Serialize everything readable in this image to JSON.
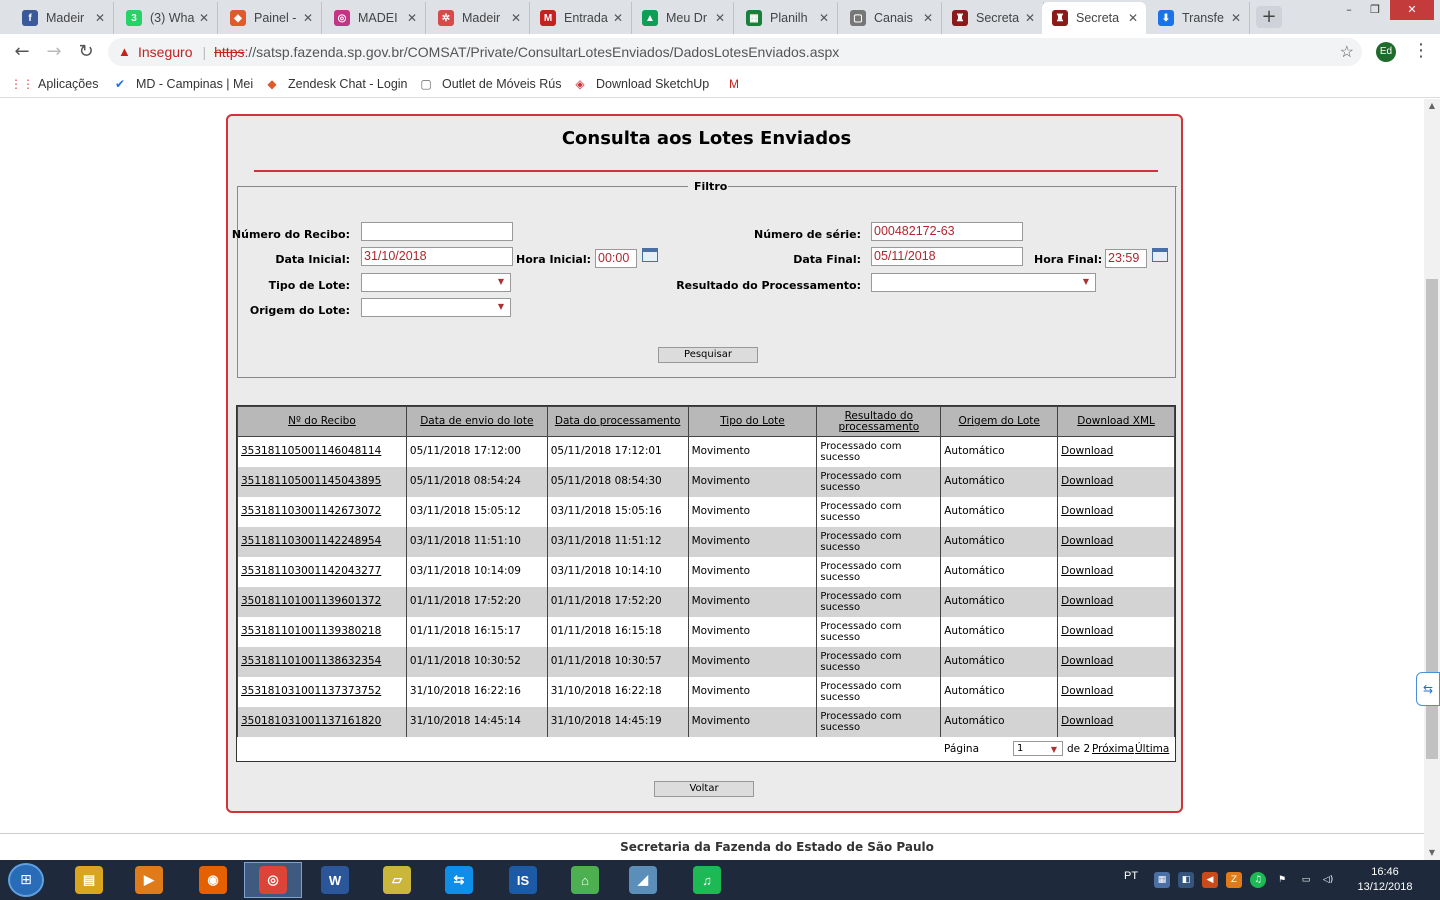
{
  "browser": {
    "tabs": [
      {
        "label": "Madeir",
        "color": "#3b5998",
        "glyph": "f"
      },
      {
        "label": "(3) Wha",
        "color": "#25d366",
        "glyph": "3"
      },
      {
        "label": "Painel -",
        "color": "#e05a2b",
        "glyph": "◆"
      },
      {
        "label": "MADEI",
        "color": "#c13584",
        "glyph": "◎"
      },
      {
        "label": "Madeir",
        "color": "#d84a4a",
        "glyph": "✲"
      },
      {
        "label": "Entrada",
        "color": "#c5221f",
        "glyph": "M"
      },
      {
        "label": "Meu Dr",
        "color": "#0f9d58",
        "glyph": "▲"
      },
      {
        "label": "Planilh",
        "color": "#188038",
        "glyph": "▦"
      },
      {
        "label": "Canais",
        "color": "#777777",
        "glyph": "▢"
      },
      {
        "label": "Secreta",
        "color": "#8b1a1a",
        "glyph": "♜"
      },
      {
        "label": "Secreta",
        "color": "#8b1a1a",
        "glyph": "♜"
      },
      {
        "label": "Transfe",
        "color": "#1a73e8",
        "glyph": "⬇"
      }
    ],
    "new_tab": "+",
    "win_controls": [
      "–",
      "❐",
      "✕"
    ],
    "back": "←",
    "forward": "→",
    "reload": "↻",
    "insecure_label": "Inseguro",
    "url_scheme": "https",
    "url_rest": "://satsp.fazenda.sp.gov.br/COMSAT/Private/ConsultarLotesEnviados/DadosLotesEnviados.aspx",
    "profile": "Ed",
    "star": "☆",
    "menu": "⋮",
    "bookmarks": [
      {
        "label": "Aplicações",
        "icon": "apps-icon",
        "glyph": "⋮⋮",
        "color": "#e8453c"
      },
      {
        "label": "MD - Campinas | Mei",
        "icon": "check-icon",
        "glyph": "✔",
        "color": "#1a73e8"
      },
      {
        "label": "Zendesk Chat - Login",
        "icon": "zendesk-icon",
        "glyph": "◆",
        "color": "#e05a2b"
      },
      {
        "label": "Outlet de Móveis Rús",
        "icon": "page-icon",
        "glyph": "▢",
        "color": "#666666"
      },
      {
        "label": "Download SketchUp",
        "icon": "sketchup-icon",
        "glyph": "◈",
        "color": "#d0343a"
      },
      {
        "label": "",
        "icon": "gmail-icon",
        "glyph": "M",
        "color": "#c5221f"
      }
    ]
  },
  "page": {
    "title": "Consulta aos Lotes Enviados",
    "filter": {
      "legend": "Filtro",
      "numero_recibo_label": "Número do Recibo:",
      "numero_recibo_value": "",
      "numero_serie_label": "Número de série:",
      "numero_serie_value": "000482172-63",
      "data_inicial_label": "Data Inicial:",
      "data_inicial_value": "31/10/2018",
      "hora_inicial_label": "Hora Inicial:",
      "hora_inicial_value": "00:00",
      "data_final_label": "Data Final:",
      "data_final_value": "05/11/2018",
      "hora_final_label": "Hora Final:",
      "hora_final_value": "23:59",
      "tipo_lote_label": "Tipo de Lote:",
      "resultado_label": "Resultado do Processamento:",
      "origem_label": "Origem do Lote:",
      "search_button": "Pesquisar"
    },
    "table": {
      "headers": [
        "Nº do Recibo",
        "Data de envio do lote",
        "Data do processamento",
        "Tipo do Lote",
        "Resultado do processamento",
        "Origem do Lote",
        "Download XML"
      ],
      "rows": [
        [
          "353181105001146048114",
          "05/11/2018 17:12:00",
          "05/11/2018 17:12:01",
          "Movimento",
          "Processado com sucesso",
          "Automático",
          "Download"
        ],
        [
          "351181105001145043895",
          "05/11/2018 08:54:24",
          "05/11/2018 08:54:30",
          "Movimento",
          "Processado com sucesso",
          "Automático",
          "Download"
        ],
        [
          "353181103001142673072",
          "03/11/2018 15:05:12",
          "03/11/2018 15:05:16",
          "Movimento",
          "Processado com sucesso",
          "Automático",
          "Download"
        ],
        [
          "351181103001142248954",
          "03/11/2018 11:51:10",
          "03/11/2018 11:51:12",
          "Movimento",
          "Processado com sucesso",
          "Automático",
          "Download"
        ],
        [
          "353181103001142043277",
          "03/11/2018 10:14:09",
          "03/11/2018 10:14:10",
          "Movimento",
          "Processado com sucesso",
          "Automático",
          "Download"
        ],
        [
          "350181101001139601372",
          "01/11/2018 17:52:20",
          "01/11/2018 17:52:20",
          "Movimento",
          "Processado com sucesso",
          "Automático",
          "Download"
        ],
        [
          "353181101001139380218",
          "01/11/2018 16:15:17",
          "01/11/2018 16:15:18",
          "Movimento",
          "Processado com sucesso",
          "Automático",
          "Download"
        ],
        [
          "353181101001138632354",
          "01/11/2018 10:30:52",
          "01/11/2018 10:30:57",
          "Movimento",
          "Processado com sucesso",
          "Automático",
          "Download"
        ],
        [
          "353181031001137373752",
          "31/10/2018 16:22:16",
          "31/10/2018 16:22:18",
          "Movimento",
          "Processado com sucesso",
          "Automático",
          "Download"
        ],
        [
          "350181031001137161820",
          "31/10/2018 14:45:14",
          "31/10/2018 14:45:19",
          "Movimento",
          "Processado com sucesso",
          "Automático",
          "Download"
        ]
      ]
    },
    "pager": {
      "label": "Página",
      "current": "1",
      "of": "de 2",
      "next": "Próxima",
      "last": "Última"
    },
    "back_button": "Voltar",
    "footer": "Secretaria da Fazenda do Estado de São Paulo"
  },
  "taskbar": {
    "apps": [
      {
        "name": "explorer-icon",
        "glyph": "▤",
        "color": "#d9a520"
      },
      {
        "name": "media-player-icon",
        "glyph": "▶",
        "color": "#e07b1a"
      },
      {
        "name": "firefox-icon",
        "glyph": "◉",
        "color": "#e66000"
      },
      {
        "name": "chrome-icon",
        "glyph": "◎",
        "color": "#db4437"
      },
      {
        "name": "word-icon",
        "glyph": "W",
        "color": "#2b579a"
      },
      {
        "name": "notes-icon",
        "glyph": "▱",
        "color": "#c9b63a"
      },
      {
        "name": "teamviewer-icon",
        "glyph": "⇆",
        "color": "#0e8ee9"
      },
      {
        "name": "is-app-icon",
        "glyph": "IS",
        "color": "#1d5aa5"
      },
      {
        "name": "network-icon",
        "glyph": "⌂",
        "color": "#4caf50"
      },
      {
        "name": "sketch-icon",
        "glyph": "◢",
        "color": "#5b8fb9"
      },
      {
        "name": "spotify-icon",
        "glyph": "♫",
        "color": "#1db954"
      }
    ],
    "lang": "PT",
    "time": "16:46",
    "date": "13/12/2018"
  }
}
